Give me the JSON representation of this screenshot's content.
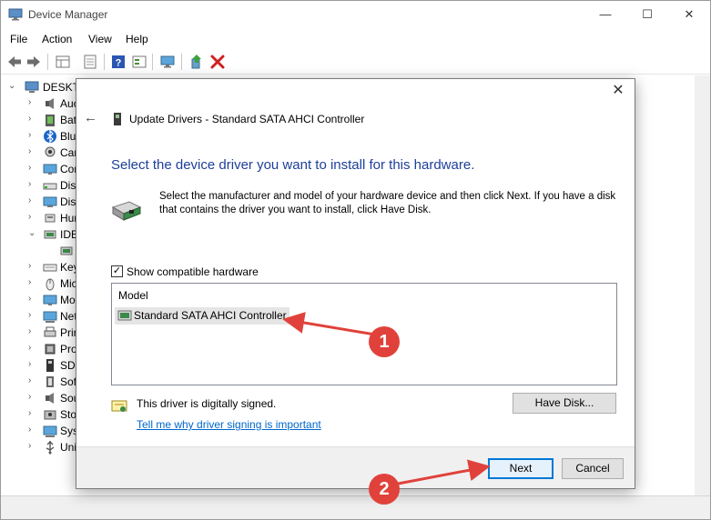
{
  "window": {
    "title": "Device Manager",
    "buttons": {
      "minimize": "—",
      "maximize": "☐",
      "close": "✕"
    }
  },
  "menu": [
    "File",
    "Action",
    "View",
    "Help"
  ],
  "toolbar": {
    "icons": [
      "back-icon",
      "forward-icon",
      "properties-grid-icon",
      "console-icon",
      "help-icon",
      "view-icon",
      "monitor-icon",
      "update-driver-icon",
      "uninstall-icon"
    ]
  },
  "tree": {
    "root": "DESKTO",
    "items": [
      {
        "label": "Auc",
        "icon": "audio-icon"
      },
      {
        "label": "Bat",
        "icon": "battery-icon"
      },
      {
        "label": "Blu",
        "icon": "bluetooth-icon"
      },
      {
        "label": "Car",
        "icon": "camera-icon"
      },
      {
        "label": "Cor",
        "icon": "computer-icon"
      },
      {
        "label": "Disl",
        "icon": "disk-icon"
      },
      {
        "label": "Disp",
        "icon": "display-icon"
      },
      {
        "label": "Hur",
        "icon": "hid-icon"
      },
      {
        "label": "IDE",
        "icon": "ide-icon",
        "expanded": true
      },
      {
        "label": "",
        "icon": "controller-icon",
        "child": true
      },
      {
        "label": "Key",
        "icon": "keyboard-icon"
      },
      {
        "label": "Mic",
        "icon": "mouse-icon"
      },
      {
        "label": "Mo",
        "icon": "monitor-icon"
      },
      {
        "label": "Net",
        "icon": "network-icon"
      },
      {
        "label": "Prir",
        "icon": "printer-icon"
      },
      {
        "label": "Pro",
        "icon": "processor-icon"
      },
      {
        "label": "SD",
        "icon": "sd-icon"
      },
      {
        "label": "Sof",
        "icon": "software-icon"
      },
      {
        "label": "Sou",
        "icon": "sound-icon"
      },
      {
        "label": "Sto",
        "icon": "storage-icon"
      },
      {
        "label": "Sys",
        "icon": "system-icon"
      },
      {
        "label": "Uni",
        "icon": "usb-icon"
      }
    ]
  },
  "dialog": {
    "header_title": "Update Drivers - Standard SATA AHCI Controller",
    "heading": "Select the device driver you want to install for this hardware.",
    "description": "Select the manufacturer and model of your hardware device and then click Next. If you have a disk that contains the driver you want to install, click Have Disk.",
    "show_compatible_label": "Show compatible hardware",
    "show_compatible_checked": true,
    "list_header": "Model",
    "models": [
      "Standard SATA AHCI Controller"
    ],
    "signed_text": "This driver is digitally signed.",
    "signed_link": "Tell me why driver signing is important",
    "have_disk_label": "Have Disk...",
    "next_label": "Next",
    "cancel_label": "Cancel"
  },
  "annotations": {
    "badge1": "1",
    "badge2": "2",
    "color": "#e0423b"
  },
  "colors": {
    "heading": "#1e3f9a",
    "link": "#0066cc",
    "accent": "#0078d7"
  }
}
